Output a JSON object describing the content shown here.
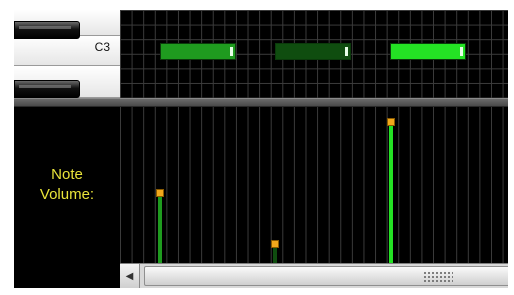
{
  "piano": {
    "visible_key_label": "C3"
  },
  "notes": [
    {
      "color": "#1f9b1f"
    },
    {
      "color": "#0f4d0f"
    },
    {
      "color": "#24e224"
    }
  ],
  "volume": {
    "label_line1": "Note",
    "label_line2": "Volume:",
    "bars": [
      {
        "level": 0.47,
        "color": "#1f9b1f"
      },
      {
        "level": 0.13,
        "color": "#0f4d0f"
      },
      {
        "level": 0.95,
        "color": "#24e224"
      }
    ]
  },
  "colors": {
    "label_text": "#e9e43a",
    "handle": "#f2a81c"
  },
  "icons": {
    "scroll_left": "left-arrow-icon",
    "grip": "grip-dots-icon"
  }
}
